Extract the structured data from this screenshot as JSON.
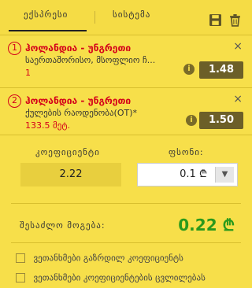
{
  "tabs": {
    "express": "ექსპრესი",
    "system": "სისტემა"
  },
  "bets": [
    {
      "number": "1",
      "title": "ჰოლანდია - უნგრეთი",
      "market": "საერთაშორისო, მსოფლიო ჩ...",
      "selection": "1",
      "odds": "1.48",
      "close": "×",
      "info": "i"
    },
    {
      "number": "2",
      "title": "ჰოლანდია - უნგრეთი",
      "market": "ქულების რაოდენობა(OT)*",
      "selection": "133.5 მეტ.",
      "odds": "1.50",
      "close": "×",
      "info": "i"
    }
  ],
  "summary": {
    "coef_label": "კოეფიციენტი",
    "stake_label": "ფსონი:",
    "coef_value": "2.22",
    "stake_value": "0.1 ₾",
    "payout_label": "შესაძლო მოგება:",
    "payout_value": "0.22 ₾"
  },
  "options": [
    {
      "label": "ვეთანხმები გაზრდილ კოეფიციენტს",
      "checked": false
    },
    {
      "label": "ვეთანხმები კოეფიციენტების ცვლილებას",
      "checked": false
    }
  ],
  "colors": {
    "background": "#f7df4a",
    "odds_badge": "#6c5f28",
    "accent_red": "#d4001a",
    "payout_green": "#2a9a1c"
  },
  "icons": {
    "save": "save-icon",
    "trash": "trash-icon",
    "dropdown": "chevron-down-icon"
  }
}
